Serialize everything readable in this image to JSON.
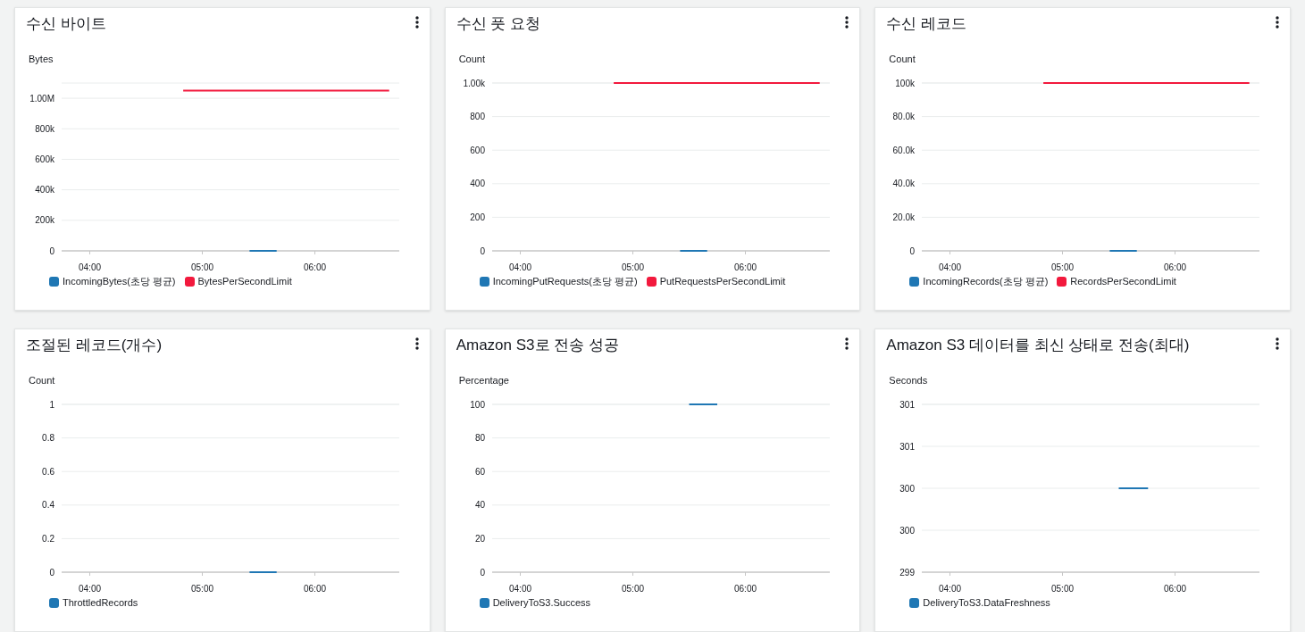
{
  "widgets": [
    {
      "chart_data": {
        "type": "line",
        "title": "수신 바이트",
        "ylabel": "Bytes",
        "grid": true,
        "x": [
          4.83,
          5.42,
          5.66,
          6.66
        ],
        "xlim": [
          3.75,
          6.75
        ],
        "ylim": [
          0,
          1100000
        ],
        "xticks": [
          {
            "value": 4,
            "label": "04:00"
          },
          {
            "value": 5,
            "label": "05:00"
          },
          {
            "value": 6,
            "label": "06:00"
          }
        ],
        "yticks": [
          {
            "value": 0,
            "label": "0"
          },
          {
            "value": 200000,
            "label": "200k"
          },
          {
            "value": 400000,
            "label": "400k"
          },
          {
            "value": 600000,
            "label": "600k"
          },
          {
            "value": 800000,
            "label": "800k"
          },
          {
            "value": 1000000,
            "label": "1.00M"
          }
        ],
        "series": [
          {
            "name": "IncomingBytes(초당 평균)",
            "color": "#1f77b4",
            "values": [
              null,
              0,
              0,
              null
            ]
          },
          {
            "name": "BytesPerSecondLimit",
            "color": "#f2193d",
            "values": [
              1050000,
              1050000,
              1050000,
              1050000
            ]
          }
        ]
      }
    },
    {
      "chart_data": {
        "type": "line",
        "title": "수신 풋 요청",
        "ylabel": "Count",
        "grid": true,
        "x": [
          4.83,
          5.42,
          5.66,
          6.66
        ],
        "xlim": [
          3.75,
          6.75
        ],
        "ylim": [
          0,
          1000
        ],
        "xticks": [
          {
            "value": 4,
            "label": "04:00"
          },
          {
            "value": 5,
            "label": "05:00"
          },
          {
            "value": 6,
            "label": "06:00"
          }
        ],
        "yticks": [
          {
            "value": 0,
            "label": "0"
          },
          {
            "value": 200,
            "label": "200"
          },
          {
            "value": 400,
            "label": "400"
          },
          {
            "value": 600,
            "label": "600"
          },
          {
            "value": 800,
            "label": "800"
          },
          {
            "value": 1000,
            "label": "1.00k"
          }
        ],
        "series": [
          {
            "name": "IncomingPutRequests(초당 평균)",
            "color": "#1f77b4",
            "values": [
              null,
              0,
              0,
              null
            ]
          },
          {
            "name": "PutRequestsPerSecondLimit",
            "color": "#f2193d",
            "values": [
              1000,
              1000,
              1000,
              1000
            ]
          }
        ]
      }
    },
    {
      "chart_data": {
        "type": "line",
        "title": "수신 레코드",
        "ylabel": "Count",
        "grid": true,
        "x": [
          4.83,
          5.42,
          5.66,
          6.66
        ],
        "xlim": [
          3.75,
          6.75
        ],
        "ylim": [
          0,
          100000
        ],
        "xticks": [
          {
            "value": 4,
            "label": "04:00"
          },
          {
            "value": 5,
            "label": "05:00"
          },
          {
            "value": 6,
            "label": "06:00"
          }
        ],
        "yticks": [
          {
            "value": 0,
            "label": "0"
          },
          {
            "value": 20000,
            "label": "20.0k"
          },
          {
            "value": 40000,
            "label": "40.0k"
          },
          {
            "value": 60000,
            "label": "60.0k"
          },
          {
            "value": 80000,
            "label": "80.0k"
          },
          {
            "value": 100000,
            "label": "100k"
          }
        ],
        "series": [
          {
            "name": "IncomingRecords(초당 평균)",
            "color": "#1f77b4",
            "values": [
              null,
              0,
              0,
              null
            ]
          },
          {
            "name": "RecordsPerSecondLimit",
            "color": "#f2193d",
            "values": [
              100000,
              100000,
              100000,
              100000
            ]
          }
        ]
      }
    },
    {
      "chart_data": {
        "type": "line",
        "title": "조절된 레코드(개수)",
        "ylabel": "Count",
        "grid": true,
        "x": [
          5.42,
          5.66
        ],
        "xlim": [
          3.75,
          6.75
        ],
        "ylim": [
          0,
          1
        ],
        "xticks": [
          {
            "value": 4,
            "label": "04:00"
          },
          {
            "value": 5,
            "label": "05:00"
          },
          {
            "value": 6,
            "label": "06:00"
          }
        ],
        "yticks": [
          {
            "value": 0,
            "label": "0"
          },
          {
            "value": 0.2,
            "label": "0.2"
          },
          {
            "value": 0.4,
            "label": "0.4"
          },
          {
            "value": 0.6,
            "label": "0.6"
          },
          {
            "value": 0.8,
            "label": "0.8"
          },
          {
            "value": 1,
            "label": "1"
          }
        ],
        "series": [
          {
            "name": "ThrottledRecords",
            "color": "#1f77b4",
            "values": [
              0,
              0
            ]
          }
        ]
      }
    },
    {
      "chart_data": {
        "type": "line",
        "title": "Amazon S3로 전송 성공",
        "ylabel": "Percentage",
        "grid": true,
        "x": [
          5.5,
          5.75
        ],
        "xlim": [
          3.75,
          6.75
        ],
        "ylim": [
          0,
          100
        ],
        "xticks": [
          {
            "value": 4,
            "label": "04:00"
          },
          {
            "value": 5,
            "label": "05:00"
          },
          {
            "value": 6,
            "label": "06:00"
          }
        ],
        "yticks": [
          {
            "value": 0,
            "label": "0"
          },
          {
            "value": 20,
            "label": "20"
          },
          {
            "value": 40,
            "label": "40"
          },
          {
            "value": 60,
            "label": "60"
          },
          {
            "value": 80,
            "label": "80"
          },
          {
            "value": 100,
            "label": "100"
          }
        ],
        "series": [
          {
            "name": "DeliveryToS3.Success",
            "color": "#1f77b4",
            "values": [
              100,
              100
            ]
          }
        ]
      }
    },
    {
      "chart_data": {
        "type": "line",
        "title": "Amazon S3 데이터를 최신 상태로 전송(최대)",
        "ylabel": "Seconds",
        "grid": true,
        "x": [
          5.5,
          5.76
        ],
        "xlim": [
          3.75,
          6.75
        ],
        "ylim": [
          299,
          301
        ],
        "xticks": [
          {
            "value": 4,
            "label": "04:00"
          },
          {
            "value": 5,
            "label": "05:00"
          },
          {
            "value": 6,
            "label": "06:00"
          }
        ],
        "yticks": [
          {
            "value": 299,
            "label": "299"
          },
          {
            "value": 299.5,
            "label": "300"
          },
          {
            "value": 300,
            "label": "300"
          },
          {
            "value": 300.5,
            "label": "301"
          },
          {
            "value": 301,
            "label": "301"
          }
        ],
        "series": [
          {
            "name": "DeliveryToS3.DataFreshness",
            "color": "#1f77b4",
            "values": [
              300,
              300
            ]
          }
        ]
      }
    }
  ]
}
